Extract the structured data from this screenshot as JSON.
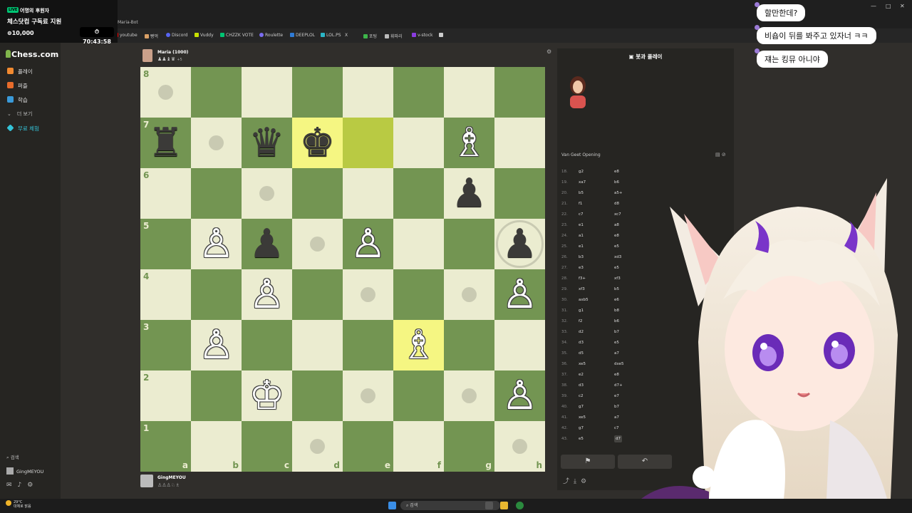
{
  "overlay": {
    "badge": "LIVE",
    "top_label": "어명의 후원자",
    "title": "체스닷컴 구독료 지원",
    "count": "10,000",
    "timer": "70:43:58"
  },
  "browser": {
    "tab_title": "Maria-Bot",
    "bookmarks": [
      "youtube",
      "빵먹",
      "Discord",
      "Vuddy",
      "CHZZK VOTE",
      "Roulette",
      "DEEPLOL",
      "LOL.PS",
      "X",
      "포팅",
      "휘파리",
      "v-stock"
    ]
  },
  "sidebar": {
    "logo": "Chess.com",
    "items": [
      {
        "label": "플레이",
        "icon": "play-icon",
        "color": "#f28a30"
      },
      {
        "label": "퍼즐",
        "icon": "puzzle-icon",
        "color": "#e86c2b"
      },
      {
        "label": "학습",
        "icon": "learn-icon",
        "color": "#3a9ad9"
      },
      {
        "label": "더 보기",
        "icon": "more-icon",
        "color": "#888888"
      },
      {
        "label": "무료 체험",
        "icon": "diamond-icon",
        "color": "#34c3d8"
      }
    ],
    "search_label": "검색",
    "username": "GingMEYOU"
  },
  "players": {
    "top_name": "Maria (1000)",
    "top_captured": "♟♟♝♛",
    "top_captured_extra": "+5",
    "bottom_name": "GingMEYOU",
    "bottom_captured": "♙♙♙♘♗"
  },
  "board": {
    "ranks": [
      "8",
      "7",
      "6",
      "5",
      "4",
      "3",
      "2",
      "1"
    ],
    "files": [
      "a",
      "b",
      "c",
      "d",
      "e",
      "f",
      "g",
      "h"
    ]
  },
  "panel": {
    "title": "봇과 플레이",
    "opening": "Van Geet Opening",
    "moves": [
      {
        "n": "18.",
        "w": "g2",
        "b": "e8"
      },
      {
        "n": "19.",
        "w": "xa7",
        "b": "b6"
      },
      {
        "n": "20.",
        "w": "b5",
        "b": "a5+"
      },
      {
        "n": "21.",
        "w": "f1",
        "b": "d8"
      },
      {
        "n": "22.",
        "w": "c7",
        "b": "xc7"
      },
      {
        "n": "23.",
        "w": "e1",
        "b": "a8"
      },
      {
        "n": "24.",
        "w": "a1",
        "b": "e8"
      },
      {
        "n": "25.",
        "w": "e1",
        "b": "e5"
      },
      {
        "n": "26.",
        "w": "b3",
        "b": "xd3"
      },
      {
        "n": "27.",
        "w": "e3",
        "b": "e5"
      },
      {
        "n": "28.",
        "w": "f3+",
        "b": "xf3"
      },
      {
        "n": "29.",
        "w": "xf3",
        "b": "b5"
      },
      {
        "n": "30.",
        "w": "axb5",
        "b": "e6"
      },
      {
        "n": "31.",
        "w": "g1",
        "b": "b8"
      },
      {
        "n": "32.",
        "w": "f2",
        "b": "b6"
      },
      {
        "n": "33.",
        "w": "d2",
        "b": "b7"
      },
      {
        "n": "34.",
        "w": "d3",
        "b": "e5"
      },
      {
        "n": "35.",
        "w": "d5",
        "b": "a7"
      },
      {
        "n": "36.",
        "w": "xe5",
        "b": "dxe5"
      },
      {
        "n": "37.",
        "w": "e2",
        "b": "e8"
      },
      {
        "n": "38.",
        "w": "d3",
        "b": "d7+"
      },
      {
        "n": "39.",
        "w": "c2",
        "b": "e7"
      },
      {
        "n": "40.",
        "w": "g7",
        "b": "b7"
      },
      {
        "n": "41.",
        "w": "xe5",
        "b": "a7"
      },
      {
        "n": "42.",
        "w": "g7",
        "b": "c7"
      },
      {
        "n": "43.",
        "w": "e5",
        "b": "d7"
      }
    ]
  },
  "chat": [
    "할만한데?",
    "비숍이 뒤를 봐주고 있자너 ㅋㅋ",
    "쟤는 킹뮤 아니야"
  ],
  "taskbar": {
    "weather_temp": "29°C",
    "weather_desc": "대체로 맑음",
    "search": "검색"
  }
}
